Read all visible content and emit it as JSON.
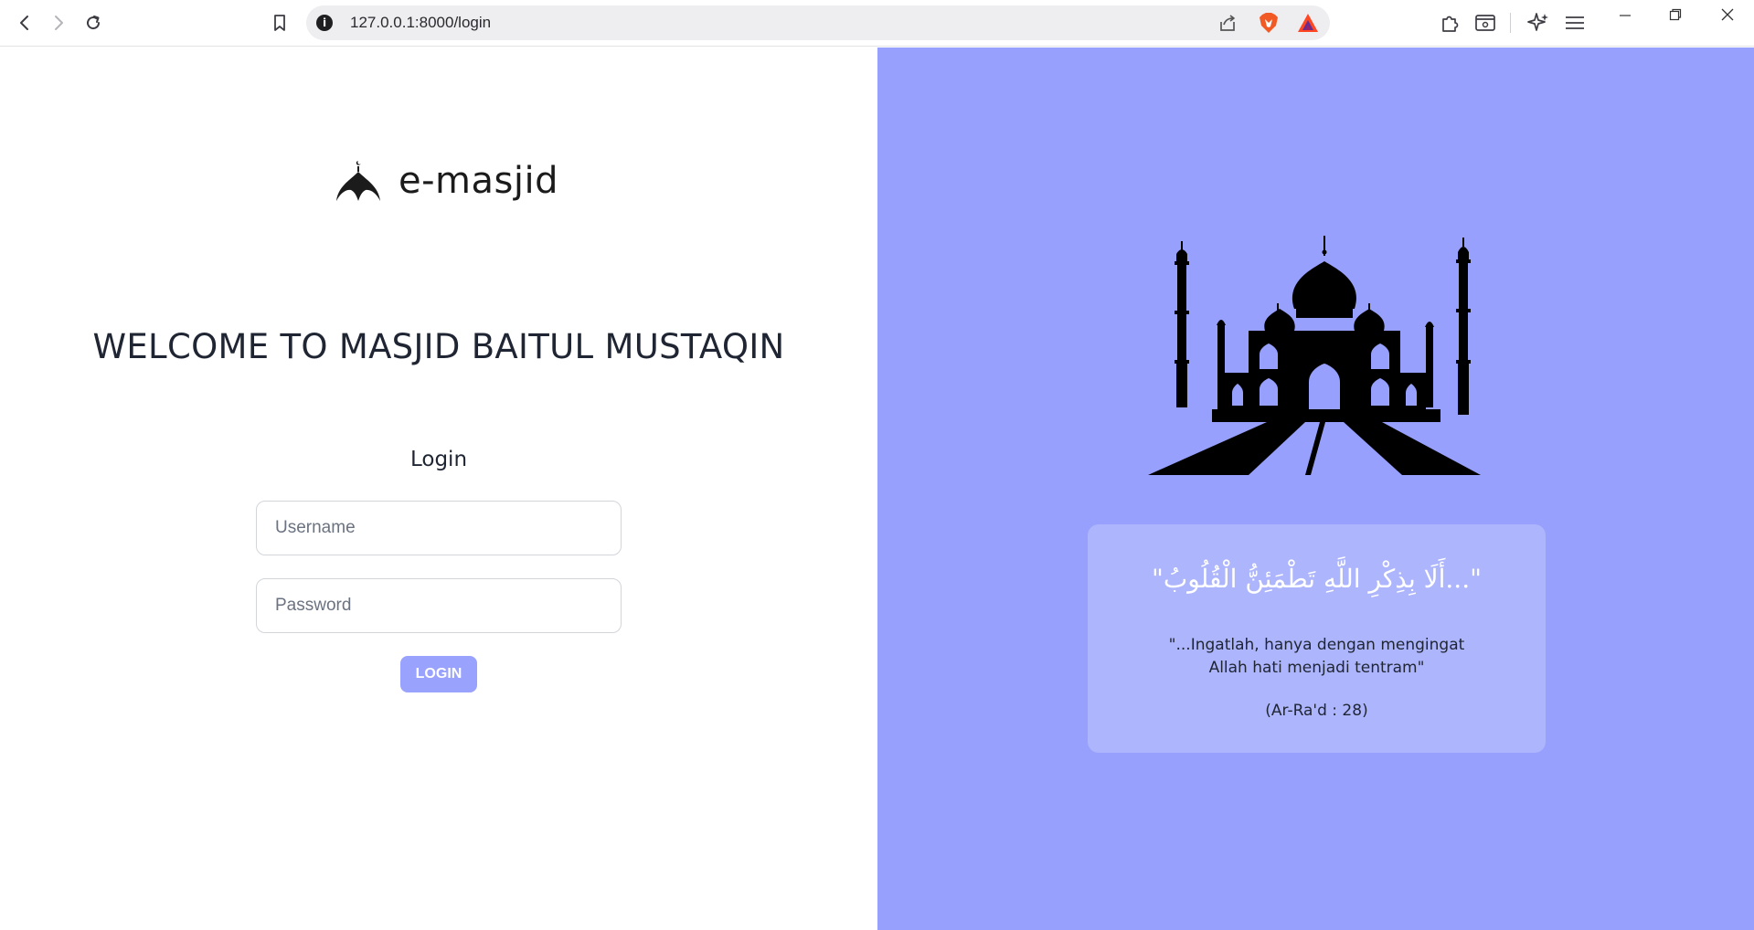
{
  "browser": {
    "url": "127.0.0.1:8000/login",
    "info_glyph": "i"
  },
  "brand": {
    "name": "e-masjid",
    "logo_icon": "mosque-dome-icon"
  },
  "welcome": "WELCOME TO MASJID BAITUL MUSTAQIN",
  "login": {
    "title": "Login",
    "username_placeholder": "Username",
    "password_placeholder": "Password",
    "button_label": "LOGIN"
  },
  "quote": {
    "arabic": "\"...أَلَا بِذِكْرِ اللَّهِ تَطْمَئِنُّ الْقُلُوبُ\"",
    "translation_line1": "\"...Ingatlah, hanya dengan mengingat",
    "translation_line2": "Allah hati menjadi tentram\"",
    "reference": "(Ar-Ra'd : 28)"
  },
  "colors": {
    "accent": "#97a0fc",
    "button": "#99a2fc",
    "text_dark": "#1f2533"
  }
}
